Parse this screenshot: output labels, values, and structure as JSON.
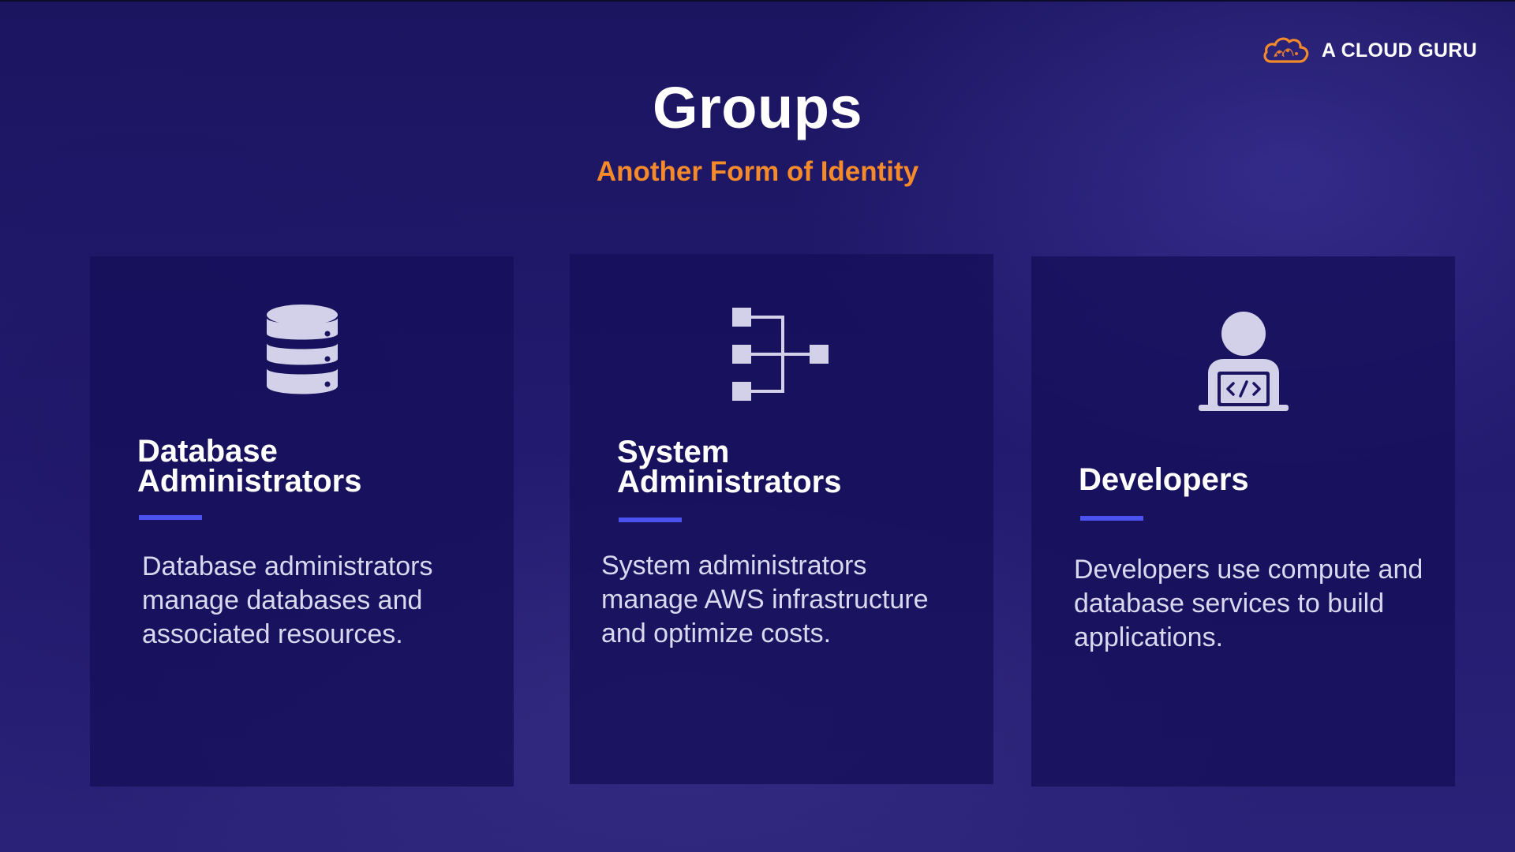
{
  "brand": {
    "name": "A CLOUD GURU",
    "logo_icon": "cloud-logo-icon",
    "logo_color": "#f58a2a"
  },
  "slide": {
    "title": "Groups",
    "subtitle": "Another Form of Identity",
    "subtitle_color": "#f58a2a",
    "accent_color": "#4a53f0"
  },
  "cards": [
    {
      "icon": "database-icon",
      "heading_line1": "Database",
      "heading_line2": "Administrators",
      "body": "Database administrators manage databases and associated resources."
    },
    {
      "icon": "hierarchy-icon",
      "heading_line1": "System",
      "heading_line2": "Administrators",
      "body": "System administrators manage AWS infrastructure and optimize costs."
    },
    {
      "icon": "developer-laptop-icon",
      "heading_line1": "Developers",
      "heading_line2": "",
      "body": "Developers use compute and database services to build applications."
    }
  ]
}
